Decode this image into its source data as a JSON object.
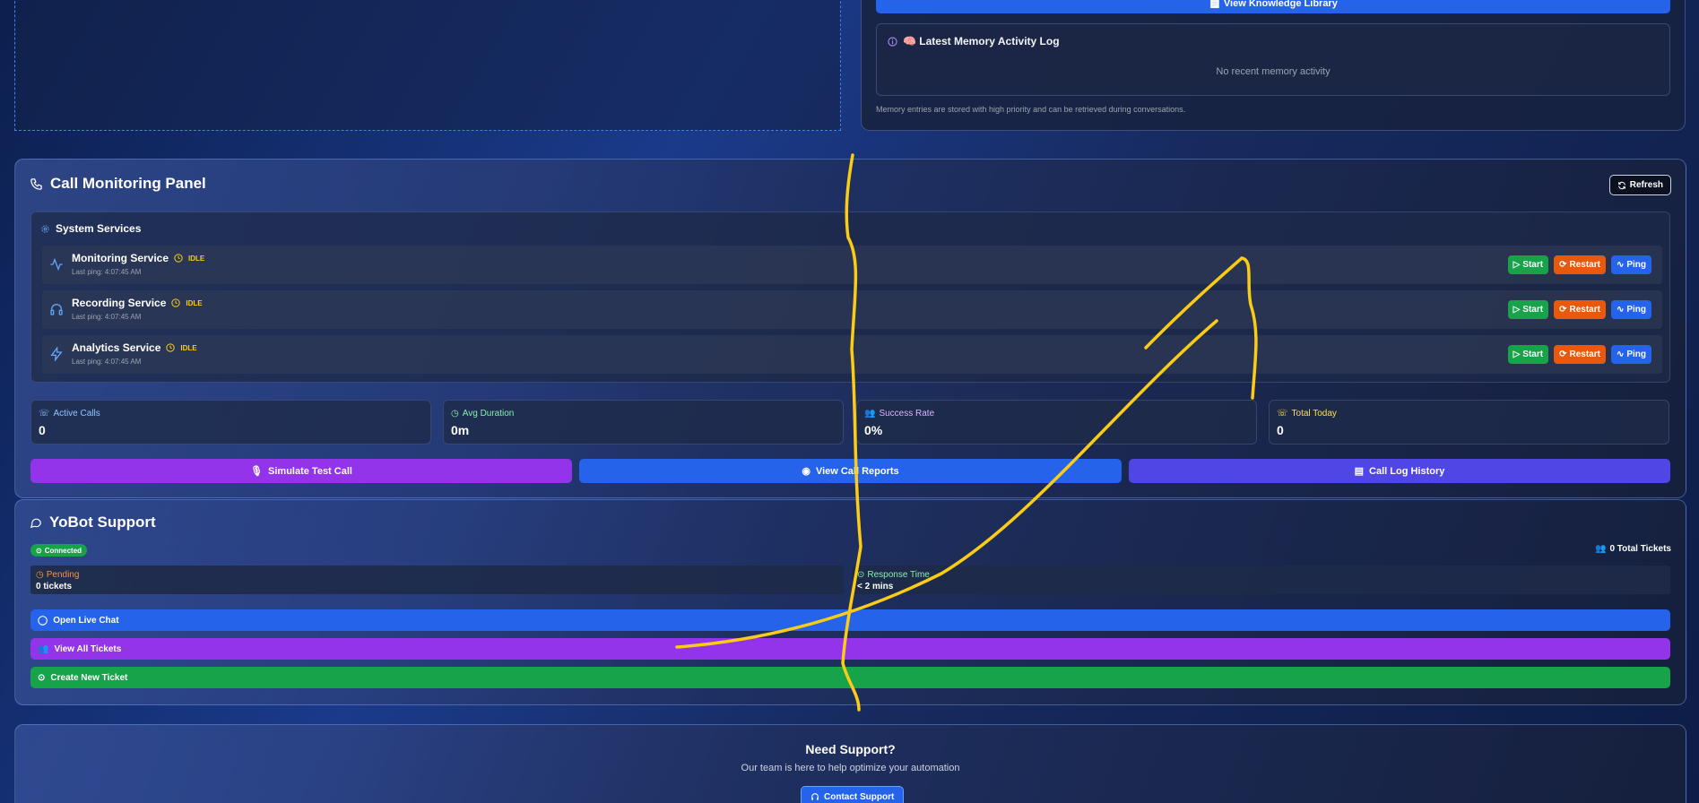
{
  "top": {
    "knowledge_button": "📄 View Knowledge Library",
    "memory_log_title": "🧠 Latest Memory Activity Log",
    "memory_empty": "No recent memory activity",
    "memory_note": "Memory entries are stored with high priority and can be retrieved during conversations."
  },
  "call_panel": {
    "title": "Call Monitoring Panel",
    "refresh_label": "Refresh",
    "services_title": "System Services",
    "services": [
      {
        "name": "Monitoring Service",
        "status": "IDLE",
        "ping": "Last ping: 4:07:45 AM",
        "icon": "activity-icon"
      },
      {
        "name": "Recording Service",
        "status": "IDLE",
        "ping": "Last ping: 4:07:45 AM",
        "icon": "headphones-icon"
      },
      {
        "name": "Analytics Service",
        "status": "IDLE",
        "ping": "Last ping: 4:07:45 AM",
        "icon": "zap-icon"
      }
    ],
    "service_buttons": {
      "start": "Start",
      "restart": "Restart",
      "ping": "Ping"
    },
    "stats": [
      {
        "label": "Active Calls",
        "value": "0",
        "color": "#93c5fd"
      },
      {
        "label": "Avg Duration",
        "value": "0m",
        "color": "#86efac"
      },
      {
        "label": "Success Rate",
        "value": "0%",
        "color": "#d8b4fe"
      },
      {
        "label": "Total Today",
        "value": "0",
        "color": "#fde047"
      }
    ],
    "actions": [
      {
        "label": "Simulate Test Call",
        "color": "#9333ea"
      },
      {
        "label": "View Call Reports",
        "color": "#2563eb"
      },
      {
        "label": "Call Log History",
        "color": "#4f46e5"
      }
    ]
  },
  "support_panel": {
    "title": "YoBot Support",
    "status_badge": "Connected",
    "total_tickets": "0 Total Tickets",
    "pending_label": "Pending",
    "pending_value": "0 tickets",
    "response_label": "Response Time",
    "response_value": "< 2 mins",
    "buttons": [
      {
        "label": "Open Live Chat",
        "color": "#2563eb"
      },
      {
        "label": "View All Tickets",
        "color": "#9333ea"
      },
      {
        "label": "Create New Ticket",
        "color": "#16a34a"
      }
    ]
  },
  "help_panel": {
    "title": "Need Support?",
    "subtitle": "Our team is here to help optimize your automation",
    "contact_button": "Contact Support"
  },
  "colors": {
    "annotation": "#facc15",
    "idle": "#facc15"
  }
}
